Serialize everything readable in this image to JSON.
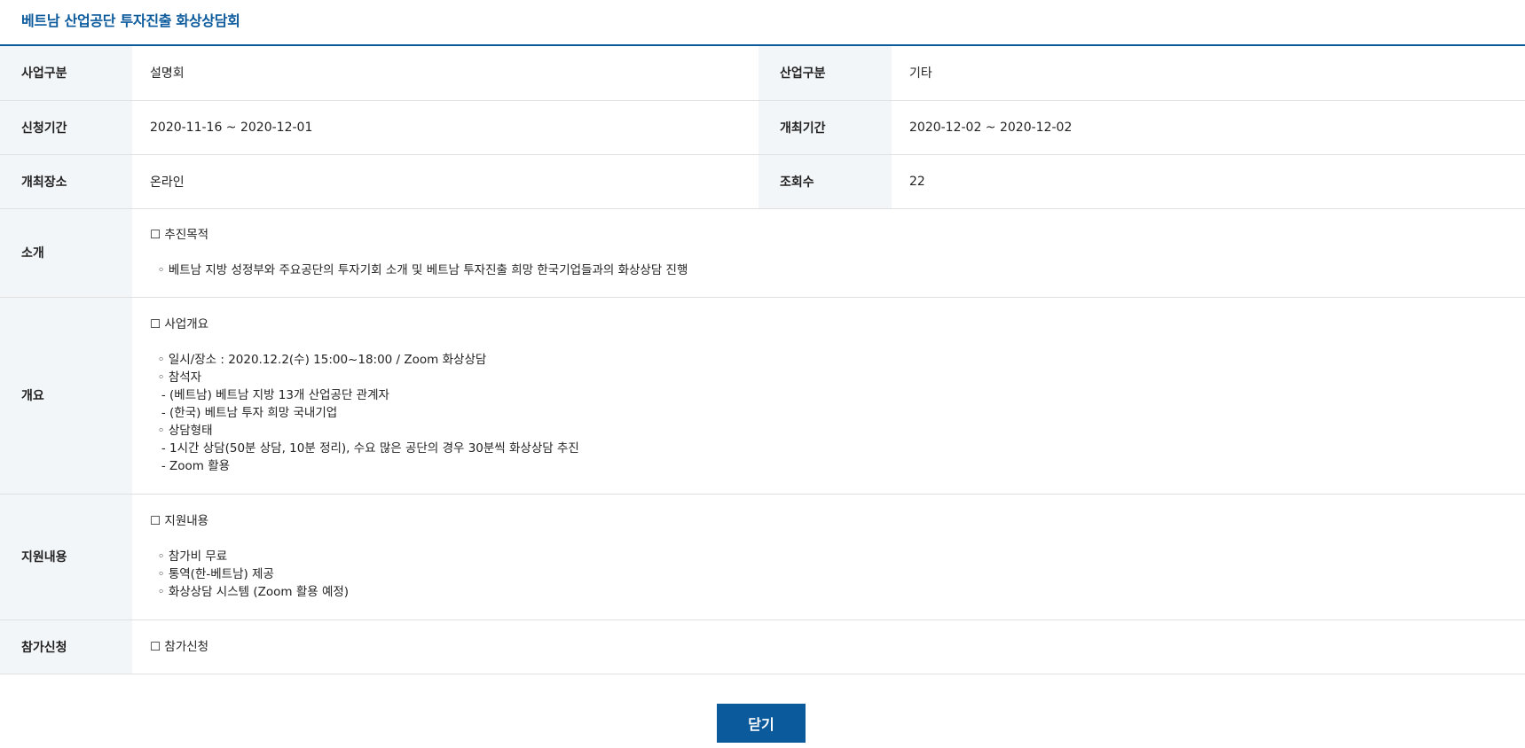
{
  "page": {
    "title": "베트남 산업공단 투자진출 화상상담회"
  },
  "fields": {
    "business_type_label": "사업구분",
    "business_type_value": "설명회",
    "industry_type_label": "산업구분",
    "industry_type_value": "기타",
    "apply_period_label": "신청기간",
    "apply_period_value": "2020-11-16 ~ 2020-12-01",
    "event_period_label": "개최기간",
    "event_period_value": "2020-12-02 ~ 2020-12-02",
    "venue_label": "개최장소",
    "venue_value": "온라인",
    "views_label": "조회수",
    "views_value": "22"
  },
  "intro": {
    "label": "소개",
    "lines": [
      "☐ 추진목적",
      "",
      "  ◦ 베트남 지방 성정부와 주요공단의 투자기회 소개 및 베트남 투자진출 희망 한국기업들과의 화상상담 진행"
    ]
  },
  "overview": {
    "label": "개요",
    "lines": [
      "☐ 사업개요",
      "",
      "  ◦ 일시/장소 : 2020.12.2(수) 15:00~18:00 / Zoom 화상상담",
      "  ◦ 참석자",
      "   - (베트남) 베트남 지방 13개 산업공단 관계자",
      "   - (한국) 베트남 투자 희망 국내기업",
      "  ◦ 상담형태",
      "   - 1시간 상담(50분 상담, 10분 정리), 수요 많은 공단의 경우 30분씩 화상상담 추진",
      "   - Zoom 활용"
    ]
  },
  "support": {
    "label": "지원내용",
    "lines": [
      "☐ 지원내용",
      "",
      "  ◦ 참가비 무료",
      "  ◦ 통역(한-베트남) 제공",
      "  ◦ 화상상담 시스템 (Zoom 활용 예정)"
    ]
  },
  "apply": {
    "label": "참가신청",
    "line": "☐ 참가신청"
  },
  "buttons": {
    "close_label": "닫기"
  },
  "colors": {
    "accent": "#0b5a9c",
    "header_bg": "#f3f6f9",
    "border": "#e0e0e0"
  }
}
